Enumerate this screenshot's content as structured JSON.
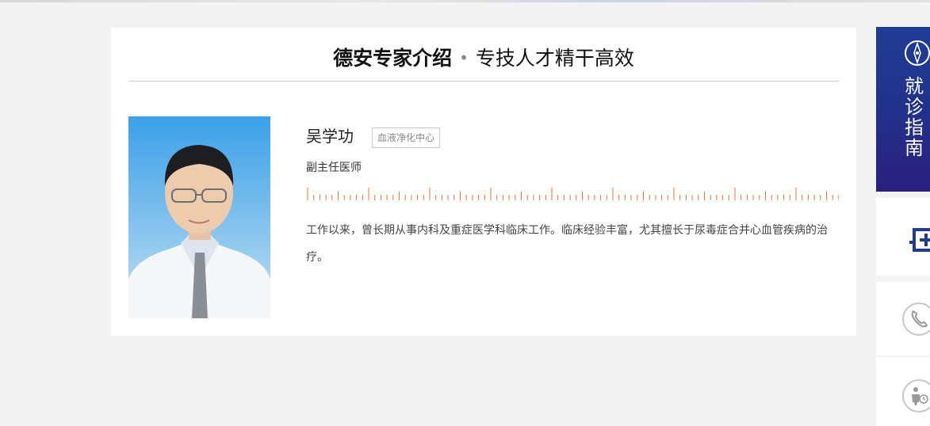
{
  "section": {
    "title_main": "德安专家介绍",
    "separator": "•",
    "title_sub": "专技人才精干高效"
  },
  "doctor": {
    "name": "吴学功",
    "department": "血液净化中心",
    "title": "副主任医师",
    "bio": "工作以来，曾长期从事内科及重症医学科临床工作。临床经验丰富，尤其擅长于尿毒症合并心血管疾病的治疗。"
  },
  "side_panel": {
    "guide_label": "就诊指南",
    "items": [
      {
        "icon": "hospital-icon"
      },
      {
        "icon": "phone-icon"
      },
      {
        "icon": "appointment-icon"
      }
    ]
  },
  "colors": {
    "ruler_accent": "#e8743b",
    "guide_blue": "#23308a",
    "page_background": "#f3f3f3"
  }
}
